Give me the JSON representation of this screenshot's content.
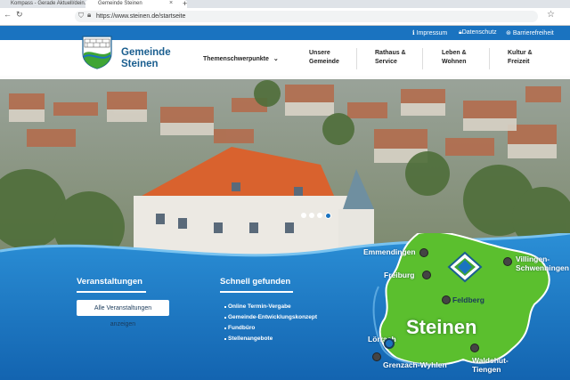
{
  "browser": {
    "tabs": [
      {
        "label": "Kompass - Gerade Aktuell/dein..."
      },
      {
        "label": "Gemeinde Steinen"
      }
    ],
    "new_tab": "+",
    "url": "https://www.steinen.de/startseite"
  },
  "topbar": {
    "impressum": "Impressum",
    "datenschutz": "Datenschutz",
    "barrierefreiheit": "Barrierefreiheit"
  },
  "header": {
    "logo_line1": "Gemeinde",
    "logo_line2": "Steinen",
    "themes": "Themenschwerpunkte",
    "nav": [
      {
        "line1": "Unsere",
        "line2": "Gemeinde"
      },
      {
        "line1": "Rathaus &",
        "line2": "Service"
      },
      {
        "line1": "Leben &",
        "line2": "Wohnen"
      },
      {
        "line1": "Kultur &",
        "line2": "Freizeit"
      }
    ]
  },
  "slider": {
    "active": 3,
    "count": 4
  },
  "events": {
    "heading": "Veranstaltungen",
    "button": "Alle Veranstaltungen anzeigen"
  },
  "quick": {
    "heading": "Schnell gefunden",
    "links": [
      "Online Termin-Vergabe",
      "Gemeinde-Entwicklungskonzept",
      "Fundbüro",
      "Stellenangebote"
    ]
  },
  "map": {
    "center_label": "Steinen",
    "cities": {
      "emmendingen": "Emmendingen",
      "freiburg": "Freiburg",
      "feldberg": "Feldberg",
      "villingen1": "Villingen-",
      "villingen2": "Schwenningen",
      "loerrach": "Lörrach",
      "grenzach": "Grenzach-Wyhlen",
      "waldshut1": "Waldshut-",
      "waldshut2": "Tiengen"
    }
  },
  "colors": {
    "brand_blue": "#1a73c0",
    "map_green": "#5bbf2e"
  }
}
